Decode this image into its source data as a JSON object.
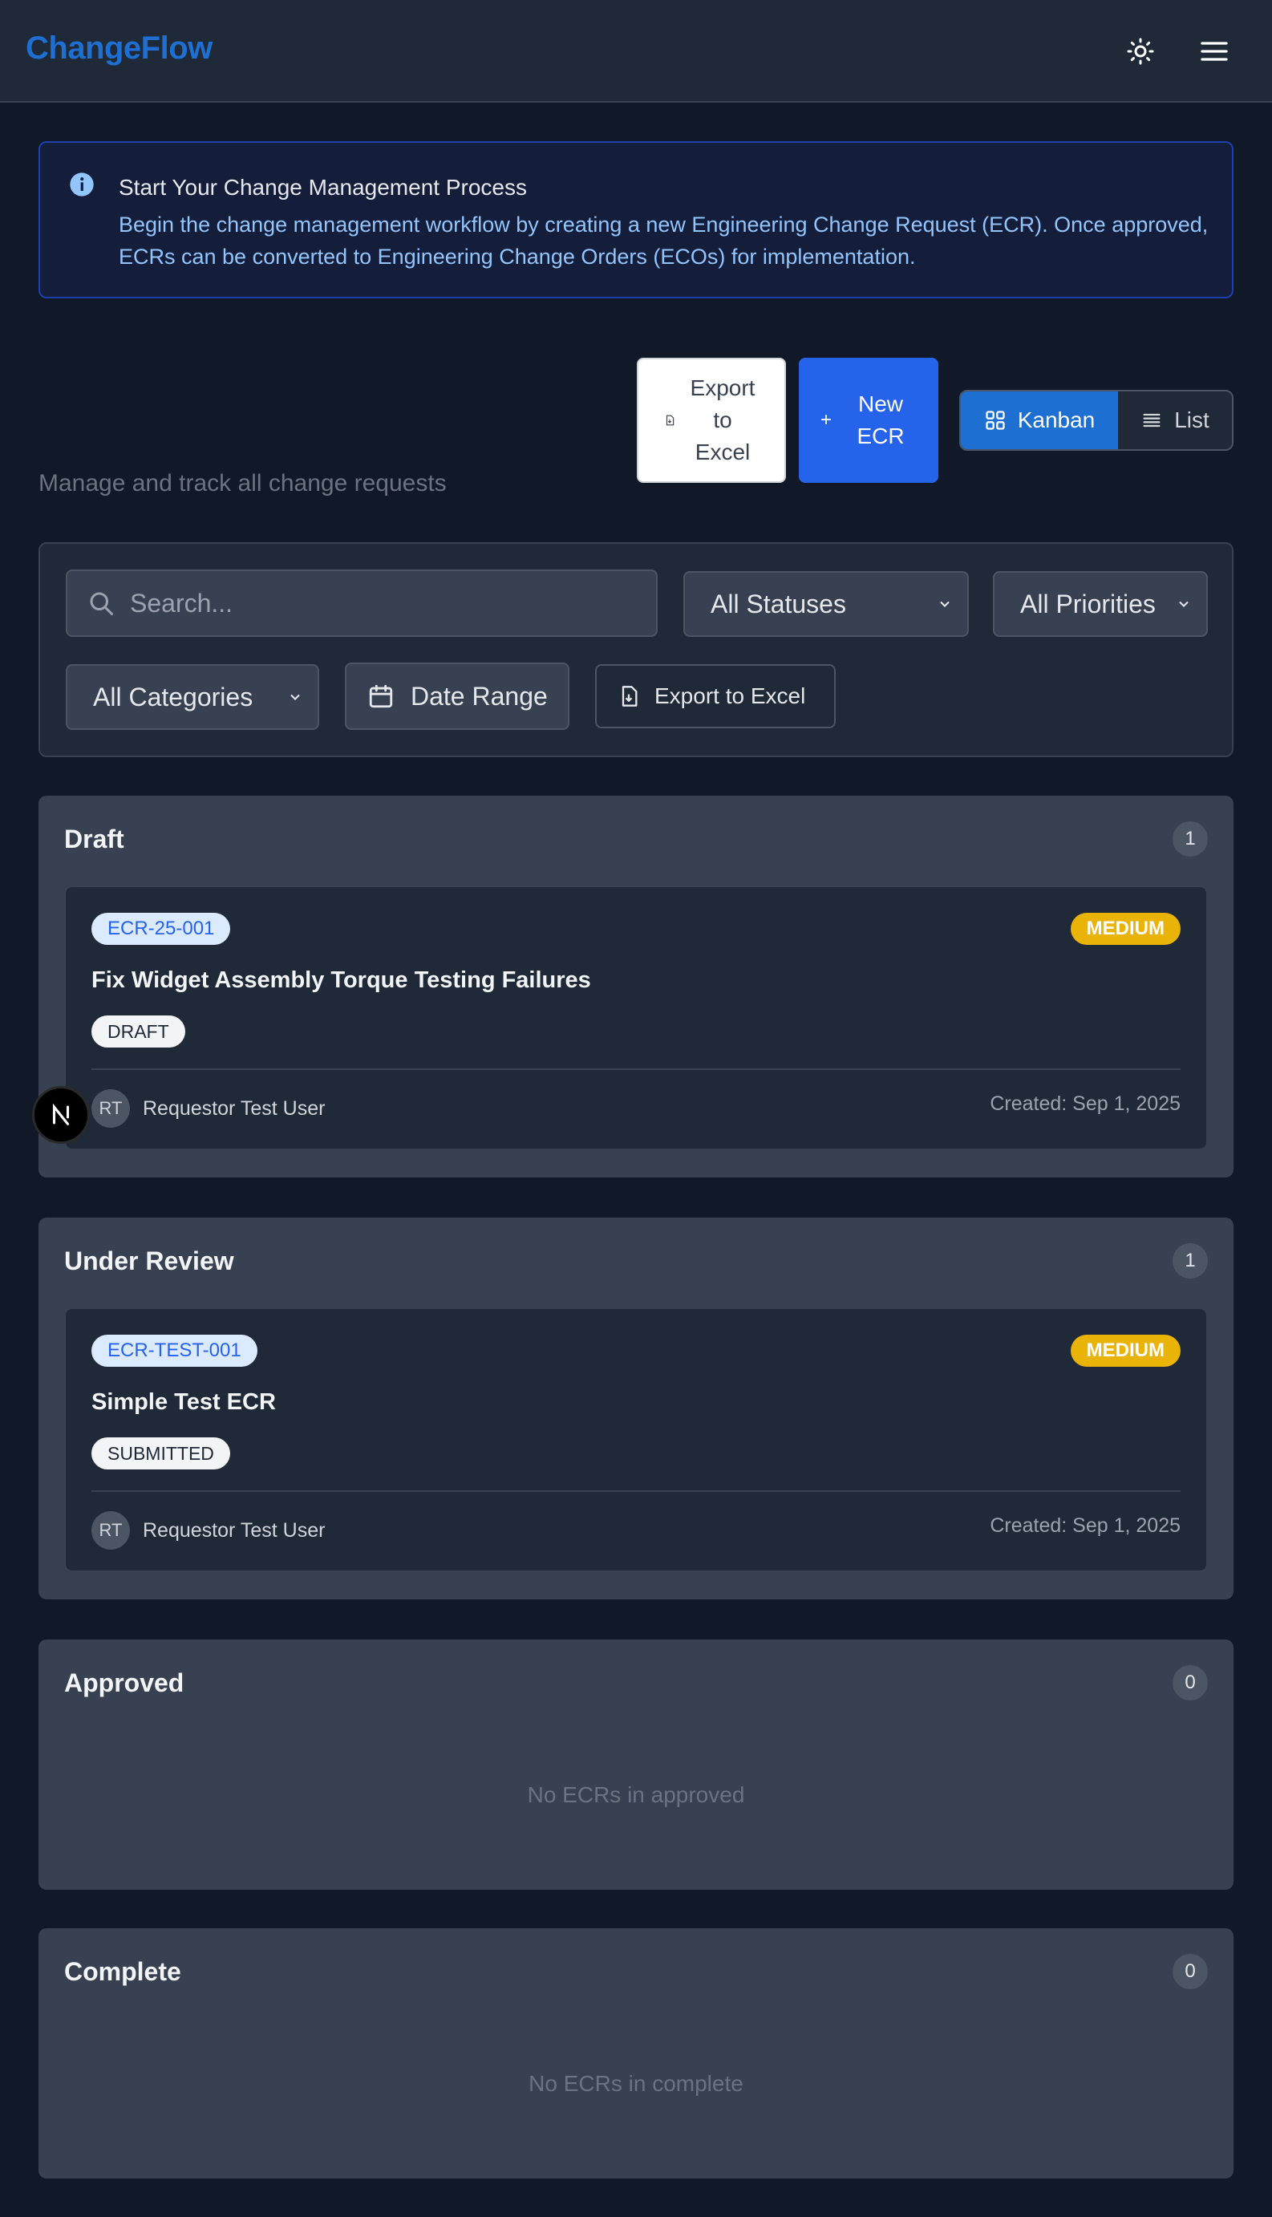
{
  "app": {
    "brand": "ChangeFlow"
  },
  "header": {
    "theme_icon": "sun-icon",
    "menu_icon": "hamburger-menu-icon"
  },
  "banner": {
    "title": "Start Your Change Management Process",
    "text": "Begin the change management workflow by creating a new Engineering Change Request (ECR). Once approved, ECRs can be converted to Engineering Change Orders (ECOs) for implementation."
  },
  "page": {
    "subtitle": "Manage and track all change requests"
  },
  "actions": {
    "export_label": "Export to Excel",
    "new_label": "New ECR",
    "views": {
      "kanban": "Kanban",
      "list": "List",
      "active": "Kanban"
    }
  },
  "filters": {
    "search_placeholder": "Search...",
    "status": "All Statuses",
    "priority": "All Priorities",
    "category": "All Categories",
    "date_range": "Date Range",
    "export_label": "Export to Excel"
  },
  "columns": [
    {
      "title": "Draft",
      "count": "1",
      "cards": [
        {
          "id": "ECR-25-001",
          "priority": "MEDIUM",
          "title": "Fix Widget Assembly Torque Testing Failures",
          "status": "DRAFT",
          "initials": "RT",
          "requestor": "Requestor Test User",
          "created": "Created: Sep 1, 2025"
        }
      ]
    },
    {
      "title": "Under Review",
      "count": "1",
      "cards": [
        {
          "id": "ECR-TEST-001",
          "priority": "MEDIUM",
          "title": "Simple Test ECR",
          "status": "SUBMITTED",
          "initials": "RT",
          "requestor": "Requestor Test User",
          "created": "Created: Sep 1, 2025"
        }
      ]
    },
    {
      "title": "Approved",
      "count": "0",
      "empty_text": "No ECRs in approved",
      "cards": []
    },
    {
      "title": "Complete",
      "count": "0",
      "empty_text": "No ECRs in complete",
      "cards": []
    }
  ],
  "colors": {
    "brand": "#1d6fd1",
    "primary": "#2563eb",
    "medium_priority": "#eab308",
    "background": "#111827"
  }
}
